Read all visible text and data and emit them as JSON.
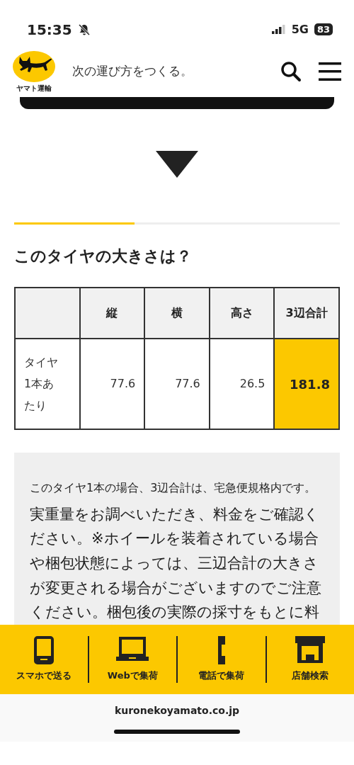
{
  "status_bar": {
    "time": "15:35",
    "network": "5G",
    "battery": "83"
  },
  "header": {
    "logo_text": "ヤマト運輸",
    "tagline": "次の運び方をつくる。"
  },
  "progress": {
    "level": 0.37
  },
  "heading": "このタイヤの大きさは？",
  "table": {
    "columns": [
      "",
      "縦",
      "横",
      "高さ",
      "3辺合計"
    ],
    "rows": [
      {
        "cells": [
          {
            "text": "タイヤ1本あたり",
            "highlighted": false
          },
          {
            "text": "77.6",
            "highlighted": false
          },
          {
            "text": "77.6",
            "highlighted": false
          },
          {
            "text": "26.5",
            "highlighted": false
          },
          {
            "text": "181.8",
            "highlighted": true
          }
        ]
      }
    ]
  },
  "note": {
    "summary": "このタイヤ1本の場合、3辺合計は、宅急便規格内です。",
    "body": "実重量をお調べいただき、料金をご確認ください。※ホイールを装着されている場合や梱包状態によっては、三辺合計の大きさが変更される場合がございますのでご注意ください。梱包後の実際の採寸をもとに料"
  },
  "bottom_nav": [
    {
      "kind": "smartphone",
      "label": "スマホで送る"
    },
    {
      "kind": "laptop",
      "label": "Webで集荷"
    },
    {
      "kind": "handset",
      "label": "電話で集荷"
    },
    {
      "kind": "store",
      "label": "店舗検索"
    }
  ],
  "url_bar": {
    "url": "kuronekoyamato.co.jp"
  }
}
